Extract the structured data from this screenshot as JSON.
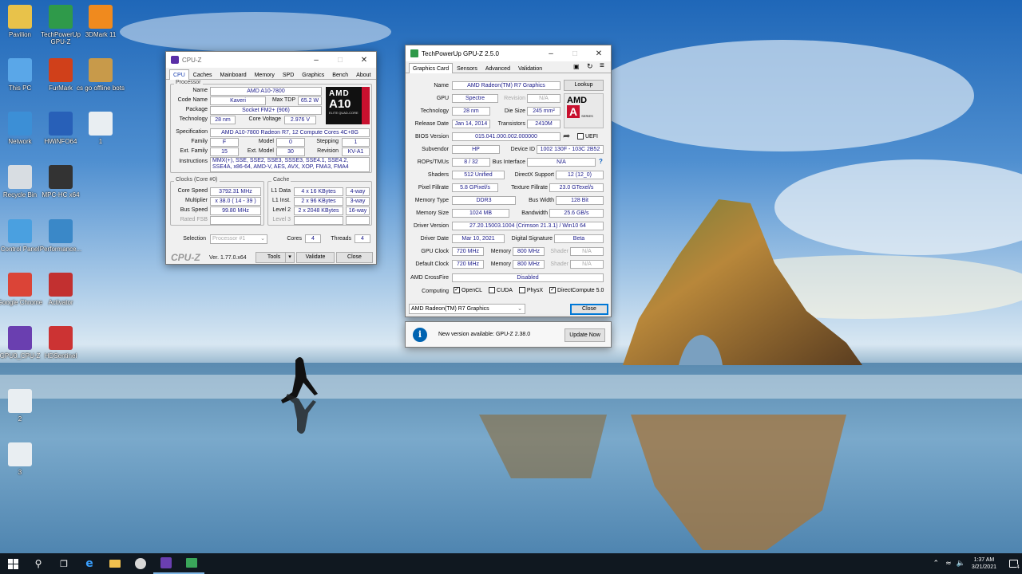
{
  "desktop": {
    "icons_col1": [
      {
        "label": "Pavilion",
        "icon": "user-folder-icon",
        "color": "#e8c24a"
      },
      {
        "label": "This PC",
        "icon": "computer-icon",
        "color": "#5aa7e8"
      },
      {
        "label": "Network",
        "icon": "network-icon",
        "color": "#3c8fd6"
      },
      {
        "label": "Recycle Bin",
        "icon": "recycle-bin-icon",
        "color": "#d8dde2"
      },
      {
        "label": "Control Panel",
        "icon": "control-panel-icon",
        "color": "#4aa0e0"
      },
      {
        "label": "Google Chrome",
        "icon": "chrome-icon",
        "color": "#db4437"
      },
      {
        "label": "GPU0_CPU-Z",
        "icon": "cpuz-icon",
        "color": "#6a3fb0"
      },
      {
        "label": "2",
        "icon": "image-file-icon",
        "color": "#e9eef2"
      },
      {
        "label": "3",
        "icon": "image-file-icon",
        "color": "#e9eef2"
      }
    ],
    "icons_col2": [
      {
        "label": "TechPowerUp GPU-Z",
        "icon": "gpuz-icon",
        "color": "#2f9a4a"
      },
      {
        "label": "FurMark",
        "icon": "furmark-icon",
        "color": "#d0401a"
      },
      {
        "label": "HWiNFO64",
        "icon": "hwinfo-icon",
        "color": "#2860b8"
      },
      {
        "label": "MPC-HC x64",
        "icon": "mpc-hc-icon",
        "color": "#333333"
      },
      {
        "label": "Performance...",
        "icon": "performance-icon",
        "color": "#3a88c8"
      },
      {
        "label": "Activator",
        "icon": "activator-icon",
        "color": "#c23030"
      },
      {
        "label": "HDSentinel",
        "icon": "hdsentinel-icon",
        "color": "#cc3333"
      }
    ],
    "icons_col3": [
      {
        "label": "3DMark 11",
        "icon": "3dmark-icon",
        "color": "#f08a1e"
      },
      {
        "label": "cs go offline bots",
        "icon": "csgo-icon",
        "color": "#c89a4a"
      },
      {
        "label": "1",
        "icon": "image-file-icon",
        "color": "#e9eef2"
      }
    ]
  },
  "cpuz": {
    "title": "CPU-Z",
    "tabs": [
      "CPU",
      "Caches",
      "Mainboard",
      "Memory",
      "SPD",
      "Graphics",
      "Bench",
      "About"
    ],
    "processor_group": "Processor",
    "name_label": "Name",
    "name": "AMD A10-7800",
    "codename_label": "Code Name",
    "codename": "Kaveri",
    "maxtdp_label": "Max TDP",
    "maxtdp": "65.2 W",
    "package_label": "Package",
    "package": "Socket FM2+ (906)",
    "tech_label": "Technology",
    "tech": "28 nm",
    "cv_label": "Core Voltage",
    "cv": "2.976 V",
    "spec_label": "Specification",
    "spec": "AMD A10-7800 Radeon R7, 12 Compute Cores 4C+8G",
    "family_label": "Family",
    "family": "F",
    "model_label": "Model",
    "model": "0",
    "stepping_label": "Stepping",
    "stepping": "1",
    "extfam_label": "Ext. Family",
    "extfam": "15",
    "extmodel_label": "Ext. Model",
    "extmodel": "30",
    "revision_label": "Revision",
    "revision": "KV-A1",
    "instr_label": "Instructions",
    "instr": "MMX(+), SSE, SSE2, SSE3, SSSE3, SSE4.1, SSE4.2, SSE4A, x86-64, AMD-V, AES, AVX, XOP, FMA3, FMA4",
    "logo_brand": "AMD",
    "logo_model": "A10",
    "logo_sub": "ELITE QUAD-CORE",
    "clocks_group": "Clocks (Core #0)",
    "corespeed_label": "Core Speed",
    "corespeed": "3792.31 MHz",
    "mult_label": "Multiplier",
    "mult": "x 38.0 ( 14 - 39 )",
    "bus_label": "Bus Speed",
    "bus": "99.80 MHz",
    "fsb_label": "Rated FSB",
    "fsb": "",
    "cache_group": "Cache",
    "l1d_label": "L1 Data",
    "l1d": "4 x 16 KBytes",
    "l1d_way": "4-way",
    "l1i_label": "L1 Inst.",
    "l1i": "2 x 96 KBytes",
    "l1i_way": "3-way",
    "l2_label": "Level 2",
    "l2": "2 x 2048 KBytes",
    "l2_way": "16-way",
    "l3_label": "Level 3",
    "l3": "",
    "l3_way": "",
    "selection_label": "Selection",
    "selection": "Processor #1",
    "cores_label": "Cores",
    "cores": "4",
    "threads_label": "Threads",
    "threads": "4",
    "brand": "CPU-Z",
    "version": "Ver. 1.77.0.x64",
    "tools_label": "Tools",
    "validate_label": "Validate",
    "close_label": "Close"
  },
  "gpuz": {
    "title": "TechPowerUp GPU-Z 2.5.0",
    "tabs": [
      "Graphics Card",
      "Sensors",
      "Advanced",
      "Validation"
    ],
    "name_label": "Name",
    "name": "AMD Radeon(TM) R7 Graphics",
    "lookup_label": "Lookup",
    "gpu_label": "GPU",
    "gpu": "Spectre",
    "revision_label": "Revision",
    "revision": "N/A",
    "tech_label": "Technology",
    "tech": "28 nm",
    "diesize_label": "Die Size",
    "diesize": "245 mm²",
    "release_label": "Release Date",
    "release": "Jan 14, 2014",
    "transistors_label": "Transistors",
    "transistors": "2410M",
    "bios_label": "BIOS Version",
    "bios": "015.041.000.002.000000",
    "uefi_label": "UEFI",
    "subvendor_label": "Subvendor",
    "subvendor": "HP",
    "deviceid_label": "Device ID",
    "deviceid": "1002 130F - 103C 2B52",
    "rops_label": "ROPs/TMUs",
    "rops": "8 / 32",
    "busif_label": "Bus Interface",
    "busif": "N/A",
    "help": "?",
    "shaders_label": "Shaders",
    "shaders": "512 Unified",
    "dx_label": "DirectX Support",
    "dx": "12 (12_0)",
    "pixfill_label": "Pixel Fillrate",
    "pixfill": "5.8 GPixel/s",
    "texfill_label": "Texture Fillrate",
    "texfill": "23.0 GTexel/s",
    "memtype_label": "Memory Type",
    "memtype": "DDR3",
    "buswidth_label": "Bus Width",
    "buswidth": "128 Bit",
    "memsize_label": "Memory Size",
    "memsize": "1024 MB",
    "bandwidth_label": "Bandwidth",
    "bandwidth": "25.6 GB/s",
    "driver_label": "Driver Version",
    "driver": "27.20.15003.1004 (Crimson 21.3.1) / Win10 64",
    "driverdate_label": "Driver Date",
    "driverdate": "Mar 10, 2021",
    "digsig_label": "Digital Signature",
    "digsig": "Beta",
    "gpuclock_label": "GPU Clock",
    "gpuclock": "720 MHz",
    "mem_label": "Memory",
    "memclock": "800 MHz",
    "shader_label": "Shader",
    "shader": "N/A",
    "defclock_label": "Default Clock",
    "defclock": "720 MHz",
    "defmem": "800 MHz",
    "defshader": "N/A",
    "crossfire_label": "AMD CrossFire",
    "crossfire": "Disabled",
    "computing_label": "Computing",
    "opencl": "OpenCL",
    "cuda": "CUDA",
    "physx": "PhysX",
    "dc": "DirectCompute 5.0",
    "logo_brand": "AMD",
    "logo_sub": "A",
    "logo_series": "SERIES",
    "select": "AMD Radeon(TM) R7 Graphics",
    "close_label": "Close"
  },
  "notify": {
    "text": "New version available: GPU-Z 2.38.0",
    "button": "Update Now",
    "icon": "i"
  },
  "taskbar": {
    "time": "1:37 AM",
    "date": "3/21/2021",
    "notif_count": "4"
  }
}
